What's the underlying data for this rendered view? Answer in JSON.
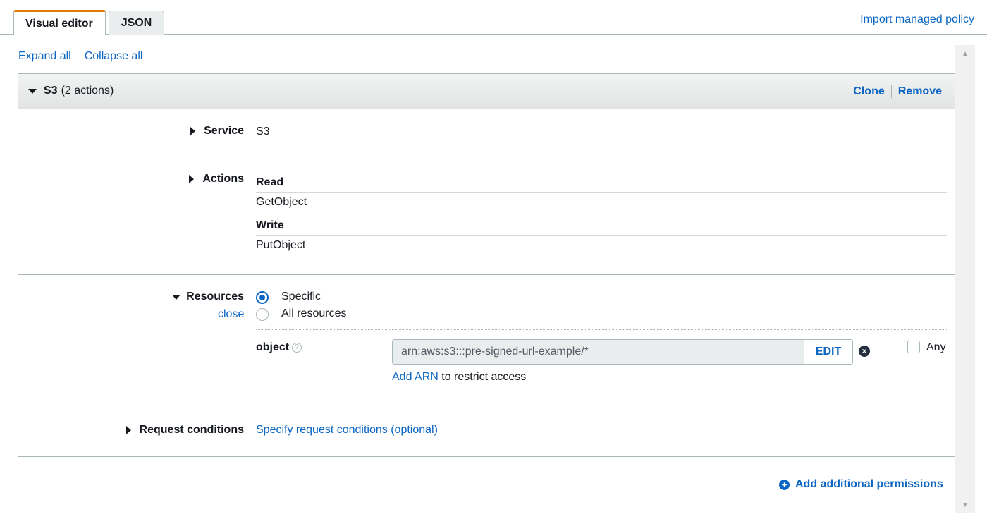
{
  "tabs": [
    {
      "label": "Visual editor",
      "active": true
    },
    {
      "label": "JSON",
      "active": false
    }
  ],
  "import_link": "Import managed policy",
  "expand_all": "Expand all",
  "collapse_all": "Collapse all",
  "statement": {
    "service_name": "S3",
    "action_count": "(2 actions)",
    "clone": "Clone",
    "remove": "Remove"
  },
  "service": {
    "label": "Service",
    "value": "S3"
  },
  "actions": {
    "label": "Actions",
    "groups": [
      {
        "heading": "Read",
        "items": [
          "GetObject"
        ]
      },
      {
        "heading": "Write",
        "items": [
          "PutObject"
        ]
      }
    ]
  },
  "resources": {
    "label": "Resources",
    "close": "close",
    "options": [
      {
        "label": "Specific",
        "selected": true
      },
      {
        "label": "All resources",
        "selected": false
      }
    ],
    "object_label": "object",
    "help_glyph": "?",
    "arn_value": "arn:aws:s3:::pre-signed-url-example/*",
    "edit_label": "EDIT",
    "remove_glyph": "×",
    "any_label": "Any",
    "any_checked": false,
    "add_arn": "Add ARN",
    "add_arn_suffix": " to restrict access"
  },
  "request_conditions": {
    "label": "Request conditions",
    "link": "Specify request conditions (optional)"
  },
  "add_permissions": "Add additional permissions",
  "add_glyph": "+",
  "colors": {
    "link": "#0b66c3",
    "tab_accent": "#e07b00",
    "border": "#aab7b8"
  },
  "icons": {
    "collapse": "triangle-down-icon",
    "expand": "triangle-right-icon",
    "help": "help-circle-icon",
    "remove": "close-circle-icon",
    "add": "plus-circle-icon"
  }
}
